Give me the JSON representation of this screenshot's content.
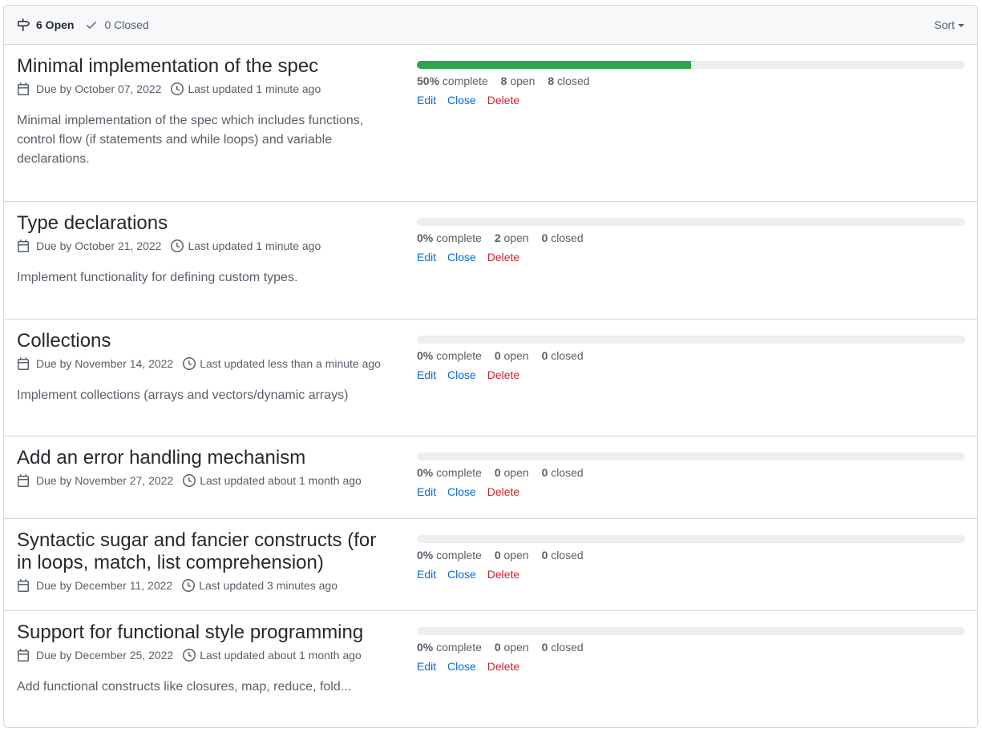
{
  "header": {
    "open_label": "6 Open",
    "closed_label": "0 Closed",
    "sort_label": "Sort"
  },
  "colors": {
    "accent": "#0969da",
    "danger": "#cf222e",
    "progress": "#2da44e",
    "track": "#eeeeee"
  },
  "labels": {
    "complete": "complete",
    "open": "open",
    "closed": "closed",
    "edit": "Edit",
    "close": "Close",
    "delete": "Delete"
  },
  "milestones": [
    {
      "title": "Minimal implementation of the spec",
      "due": "Due by October 07, 2022",
      "updated": "Last updated 1 minute ago",
      "description": "Minimal implementation of the spec which includes functions, control flow (if statements and while loops) and variable declarations.",
      "progress": 0.5,
      "percent": "50%",
      "open": "8",
      "closed": "8"
    },
    {
      "title": "Type declarations",
      "due": "Due by October 21, 2022",
      "updated": "Last updated 1 minute ago",
      "description": "Implement functionality for defining custom types.",
      "progress": 0,
      "percent": "0%",
      "open": "2",
      "closed": "0"
    },
    {
      "title": "Collections",
      "due": "Due by November 14, 2022",
      "updated": "Last updated less than a minute ago",
      "description": "Implement collections (arrays and vectors/dynamic arrays)",
      "progress": 0,
      "percent": "0%",
      "open": "0",
      "closed": "0"
    },
    {
      "title": "Add an error handling mechanism",
      "due": "Due by November 27, 2022",
      "updated": "Last updated about 1 month ago",
      "description": "",
      "progress": 0,
      "percent": "0%",
      "open": "0",
      "closed": "0"
    },
    {
      "title": "Syntactic sugar and fancier constructs (for in loops, match, list comprehension)",
      "due": "Due by December 11, 2022",
      "updated": "Last updated 3 minutes ago",
      "description": "",
      "progress": 0,
      "percent": "0%",
      "open": "0",
      "closed": "0"
    },
    {
      "title": "Support for functional style programming",
      "due": "Due by December 25, 2022",
      "updated": "Last updated about 1 month ago",
      "description": "Add functional constructs like closures, map, reduce, fold...",
      "progress": 0,
      "percent": "0%",
      "open": "0",
      "closed": "0"
    }
  ]
}
